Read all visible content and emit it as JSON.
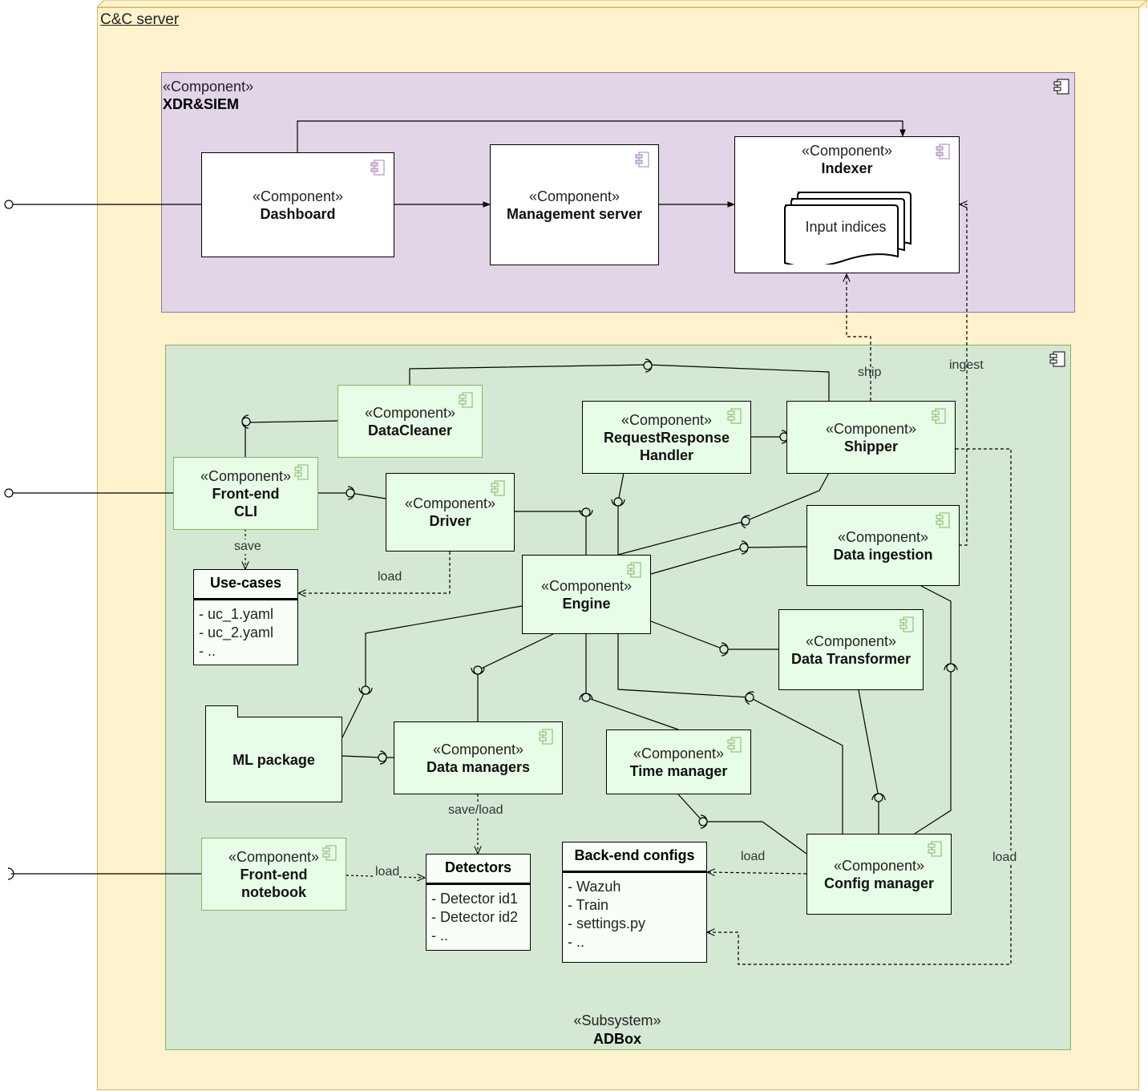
{
  "node": {
    "title": "C&C server"
  },
  "xdr": {
    "stereotype": "«Component»",
    "name": "XDR&SIEM",
    "components": {
      "dashboard": {
        "stereotype": "«Component»",
        "name": "Dashboard"
      },
      "management": {
        "stereotype": "«Component»",
        "name": "Management server"
      },
      "indexer": {
        "stereotype": "«Component»",
        "name": "Indexer",
        "document": "Input indices"
      }
    }
  },
  "adbox": {
    "stereotype": "«Subsystem»",
    "name": "ADBox",
    "components": {
      "datacleaner": {
        "stereotype": "«Component»",
        "name": "DataCleaner"
      },
      "frontend_cli": {
        "stereotype": "«Component»",
        "name1": "Front-end",
        "name2": "CLI"
      },
      "driver": {
        "stereotype": "«Component»",
        "name": "Driver"
      },
      "rrhandler": {
        "stereotype": "«Component»",
        "name1": "RequestResponse",
        "name2": "Handler"
      },
      "shipper": {
        "stereotype": "«Component»",
        "name": "Shipper"
      },
      "ingestion": {
        "stereotype": "«Component»",
        "name": "Data ingestion"
      },
      "engine": {
        "stereotype": "«Component»",
        "name": "Engine"
      },
      "transformer": {
        "stereotype": "«Component»",
        "name": "Data Transformer"
      },
      "datamanagers": {
        "stereotype": "«Component»",
        "name": "Data managers"
      },
      "timemanager": {
        "stereotype": "«Component»",
        "name": "Time manager"
      },
      "configmanager": {
        "stereotype": "«Component»",
        "name": "Config manager"
      },
      "frontend_nb": {
        "stereotype": "«Component»",
        "name1": "Front-end",
        "name2": "notebook"
      }
    },
    "ml_package": {
      "name": "ML package"
    },
    "usecases": {
      "title": "Use-cases",
      "items": [
        "- uc_1.yaml",
        "- uc_2.yaml",
        "- .."
      ]
    },
    "detectors": {
      "title": "Detectors",
      "items": [
        "- Detector id1",
        "- Detector id2",
        "- .."
      ]
    },
    "backend_configs": {
      "title": "Back-end configs",
      "items": [
        "- Wazuh",
        "- Train",
        "- settings.py",
        "- .."
      ]
    }
  },
  "edge_labels": {
    "ship": "ship",
    "ingest": "ingest",
    "save": "save",
    "load_usecases": "load",
    "save_load": "save/load",
    "load_detectors": "load",
    "load_configs": "load",
    "load_configs_shipper": "load"
  },
  "colors": {
    "node_fill": "#fff2cc",
    "node_stroke": "#d6b656",
    "xdr_fill": "#e1d5e7",
    "xdr_stroke": "#9673a6",
    "adbox_fill": "#d5e8d4",
    "adbox_stroke": "#82b366",
    "component_fill": "#e8fde7"
  }
}
